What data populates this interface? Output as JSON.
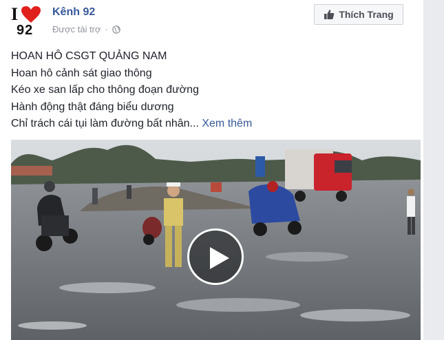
{
  "post": {
    "page_name": "Kênh 92",
    "sponsored_label": "Được tài trợ",
    "separator": "·",
    "like_button": "Thích Trang",
    "avatar_text": {
      "letter": "I",
      "number": "92"
    },
    "text_lines": [
      "HOAN HÔ CSGT QUẢNG NAM",
      "Hoan hô cảnh sát giao thông",
      "Kéo xe san lấp cho thông đoạn đường",
      "Hành động thật đáng biểu dương",
      "Chỉ trách cái tụi làm đường bất nhân..."
    ],
    "see_more": "Xem thêm"
  },
  "icons": {
    "heart": "heart-icon",
    "globe": "globe-icon",
    "like": "thumbs-up-icon",
    "play": "play-icon"
  },
  "colors": {
    "link": "#365899",
    "text": "#1d2129",
    "muted": "#90949c",
    "heart": "#e0211b"
  }
}
